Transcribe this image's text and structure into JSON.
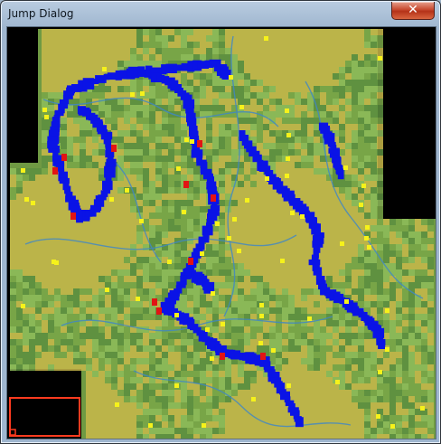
{
  "window": {
    "title": "Jump Dialog",
    "close_glyph": "✕",
    "close_icon": "close-icon"
  },
  "minimap": {
    "background": "#000000",
    "terrain_colors": [
      "#5d8f3f",
      "#7aa748",
      "#c9b84a",
      "#8fbd5a"
    ],
    "river_color": "#3f86c8",
    "territory_colors": {
      "player": "#0a13e6",
      "enemy": "#e21414",
      "city": "#f6f21a"
    },
    "viewport_color": "#ff3b1f"
  }
}
